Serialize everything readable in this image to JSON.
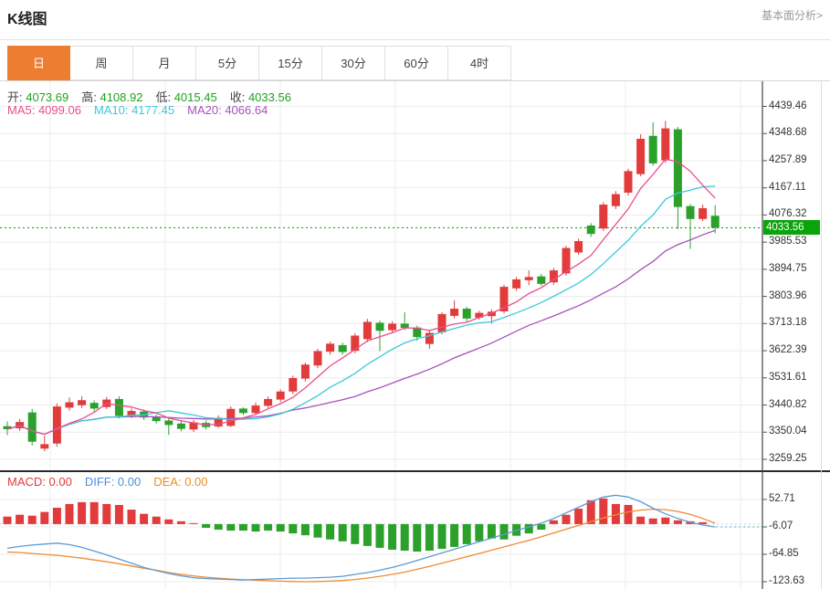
{
  "header": {
    "title": "K线图",
    "link": "基本面分析>"
  },
  "tabs": {
    "items": [
      {
        "name": "day",
        "label": "日",
        "active": true
      },
      {
        "name": "week",
        "label": "周",
        "active": false
      },
      {
        "name": "month",
        "label": "月",
        "active": false
      },
      {
        "name": "5min",
        "label": "5分",
        "active": false
      },
      {
        "name": "15min",
        "label": "15分",
        "active": false
      },
      {
        "name": "30min",
        "label": "30分",
        "active": false
      },
      {
        "name": "60min",
        "label": "60分",
        "active": false
      },
      {
        "name": "4hour",
        "label": "4时",
        "active": false
      }
    ]
  },
  "info": {
    "ohlc": [
      {
        "name": "open",
        "label": "开:",
        "value": "4073.69"
      },
      {
        "name": "high",
        "label": "高:",
        "value": "4108.92"
      },
      {
        "name": "low",
        "label": "低:",
        "value": "4015.45"
      },
      {
        "name": "close",
        "label": "收:",
        "value": "4033.56"
      }
    ],
    "ma": [
      {
        "name": "ma5",
        "label": "MA5:",
        "value": "4099.06",
        "color": "#eb4d8c"
      },
      {
        "name": "ma10",
        "label": "MA10:",
        "value": "4177.45",
        "color": "#3ec7d9"
      },
      {
        "name": "ma20",
        "label": "MA20:",
        "value": "4066.64",
        "color": "#a653bd"
      }
    ],
    "macd": [
      {
        "name": "macd",
        "label": "MACD:",
        "value": "0.00",
        "color": "#e23b3b"
      },
      {
        "name": "diff",
        "label": "DIFF:",
        "value": "0.00",
        "color": "#4a90d9"
      },
      {
        "name": "dea",
        "label": "DEA:",
        "value": "0.00",
        "color": "#f08c1e"
      }
    ]
  },
  "axis": {
    "main_ticks": [
      4439.46,
      4348.68,
      4257.89,
      4167.11,
      4076.32,
      3985.53,
      3894.75,
      3803.96,
      3713.18,
      3622.39,
      3531.61,
      3440.82,
      3350.04,
      3259.25
    ],
    "macd_ticks": [
      52.71,
      -6.07,
      -64.85,
      -123.63
    ],
    "price_badge": "4033.56"
  },
  "colors": {
    "up": "#e23b3b",
    "down": "#2ba12b",
    "ma5": "#eb4d8c",
    "ma10": "#3ec7d9",
    "ma20": "#a653bd",
    "diff_line": "#5b9bd5",
    "dea_line": "#ef8b31",
    "badge_bg": "#0aa30a",
    "dotted_price": "#18a318",
    "dotted_macd": "#7ecfe0",
    "grid": "#ececec",
    "axis_line": "#444",
    "separator": "#2a2a2a",
    "ohlc_value": "#1fa31f",
    "ohlc_label": "#444"
  },
  "chart_data": {
    "type": "candlestick+macd",
    "candle_format": "[open, high, low, close]",
    "last_price": 4033.56,
    "main_pane": {
      "ylim": [
        3259.25,
        4439.46
      ],
      "grid": true,
      "candles": [
        [
          3370,
          3386,
          3340,
          3360
        ],
        [
          3363,
          3394,
          3354,
          3384
        ],
        [
          3416,
          3428,
          3306,
          3318
        ],
        [
          3295,
          3338,
          3286,
          3310
        ],
        [
          3312,
          3446,
          3302,
          3436
        ],
        [
          3432,
          3466,
          3422,
          3450
        ],
        [
          3440,
          3470,
          3431,
          3457
        ],
        [
          3448,
          3456,
          3419,
          3429
        ],
        [
          3434,
          3468,
          3427,
          3459
        ],
        [
          3461,
          3470,
          3396,
          3404
        ],
        [
          3405,
          3429,
          3397,
          3421
        ],
        [
          3419,
          3426,
          3391,
          3399
        ],
        [
          3401,
          3409,
          3379,
          3387
        ],
        [
          3389,
          3396,
          3341,
          3374
        ],
        [
          3379,
          3389,
          3353,
          3361
        ],
        [
          3359,
          3391,
          3351,
          3383
        ],
        [
          3381,
          3389,
          3359,
          3367
        ],
        [
          3369,
          3406,
          3364,
          3398
        ],
        [
          3371,
          3436,
          3367,
          3428
        ],
        [
          3429,
          3433,
          3407,
          3414
        ],
        [
          3414,
          3449,
          3409,
          3439
        ],
        [
          3438,
          3469,
          3431,
          3461
        ],
        [
          3459,
          3493,
          3451,
          3486
        ],
        [
          3486,
          3539,
          3477,
          3531
        ],
        [
          3529,
          3583,
          3519,
          3576
        ],
        [
          3573,
          3629,
          3564,
          3621
        ],
        [
          3619,
          3653,
          3609,
          3646
        ],
        [
          3641,
          3649,
          3609,
          3618
        ],
        [
          3622,
          3681,
          3614,
          3673
        ],
        [
          3661,
          3729,
          3651,
          3719
        ],
        [
          3716,
          3723,
          3621,
          3689
        ],
        [
          3691,
          3721,
          3681,
          3713
        ],
        [
          3713,
          3751,
          3691,
          3699
        ],
        [
          3700,
          3706,
          3655,
          3668
        ],
        [
          3645,
          3690,
          3629,
          3682
        ],
        [
          3684,
          3751,
          3677,
          3745
        ],
        [
          3739,
          3791,
          3731,
          3763
        ],
        [
          3763,
          3769,
          3721,
          3730
        ],
        [
          3733,
          3756,
          3726,
          3749
        ],
        [
          3738,
          3761,
          3713,
          3753
        ],
        [
          3754,
          3843,
          3747,
          3836
        ],
        [
          3831,
          3869,
          3823,
          3861
        ],
        [
          3858,
          3891,
          3841,
          3869
        ],
        [
          3871,
          3879,
          3839,
          3846
        ],
        [
          3851,
          3899,
          3843,
          3891
        ],
        [
          3881,
          3973,
          3873,
          3966
        ],
        [
          3951,
          3997,
          3943,
          3989
        ],
        [
          4041,
          4049,
          4003,
          4013
        ],
        [
          4031,
          4119,
          4023,
          4111
        ],
        [
          4106,
          4156,
          4096,
          4146
        ],
        [
          4151,
          4231,
          4141,
          4223
        ],
        [
          4213,
          4346,
          4206,
          4331
        ],
        [
          4341,
          4386,
          4241,
          4249
        ],
        [
          4259,
          4391,
          4251,
          4366
        ],
        [
          4363,
          4371,
          4029,
          4103
        ],
        [
          4106,
          4113,
          3963,
          4063
        ],
        [
          4063,
          4111,
          4056,
          4099
        ],
        [
          4073.69,
          4108.92,
          4015.45,
          4033.56
        ]
      ],
      "ma_windows": [
        5,
        10,
        20
      ]
    },
    "macd_pane": {
      "ylim": [
        -123.63,
        52.71
      ],
      "hist": [
        16,
        20,
        18,
        26,
        35,
        43,
        47,
        47,
        43,
        41,
        31,
        22,
        16,
        10,
        6,
        2,
        -8,
        -12,
        -14,
        -14,
        -16,
        -14,
        -16,
        -20,
        -24,
        -29,
        -33,
        -37,
        -43,
        -47,
        -51,
        -55,
        -57,
        -59,
        -57,
        -53,
        -49,
        -43,
        -37,
        -31,
        -33,
        -25,
        -20,
        -12,
        8,
        20,
        33,
        51,
        55,
        43,
        41,
        16,
        12,
        14,
        8,
        6,
        4,
        0
      ],
      "diff": [
        -52,
        -48,
        -45,
        -43,
        -41,
        -44,
        -50,
        -58,
        -66,
        -75,
        -84,
        -93,
        -100,
        -106,
        -111,
        -115,
        -117,
        -118,
        -119,
        -120,
        -119,
        -118,
        -117,
        -116,
        -116,
        -115,
        -114,
        -112,
        -108,
        -104,
        -99,
        -93,
        -86,
        -78,
        -70,
        -62,
        -54,
        -46,
        -38,
        -30,
        -22,
        -14,
        -6,
        2,
        12,
        24,
        36,
        48,
        58,
        62,
        58,
        48,
        34,
        22,
        12,
        4,
        -2,
        -6
      ],
      "dea": [
        -60,
        -61,
        -63,
        -65,
        -67,
        -70,
        -73,
        -77,
        -81,
        -85,
        -90,
        -95,
        -99,
        -104,
        -108,
        -111,
        -114,
        -116,
        -118,
        -119.5,
        -120.5,
        -121.5,
        -122.5,
        -123.3,
        -123.6,
        -123.3,
        -122.5,
        -121,
        -119,
        -116,
        -112,
        -108,
        -103,
        -97,
        -91,
        -84,
        -77,
        -70,
        -63,
        -56,
        -49,
        -42,
        -35,
        -27,
        -19,
        -11,
        -3,
        5,
        13,
        20,
        26,
        30,
        32,
        31,
        27,
        21,
        12,
        2
      ],
      "dotted_level": -6.07
    }
  }
}
